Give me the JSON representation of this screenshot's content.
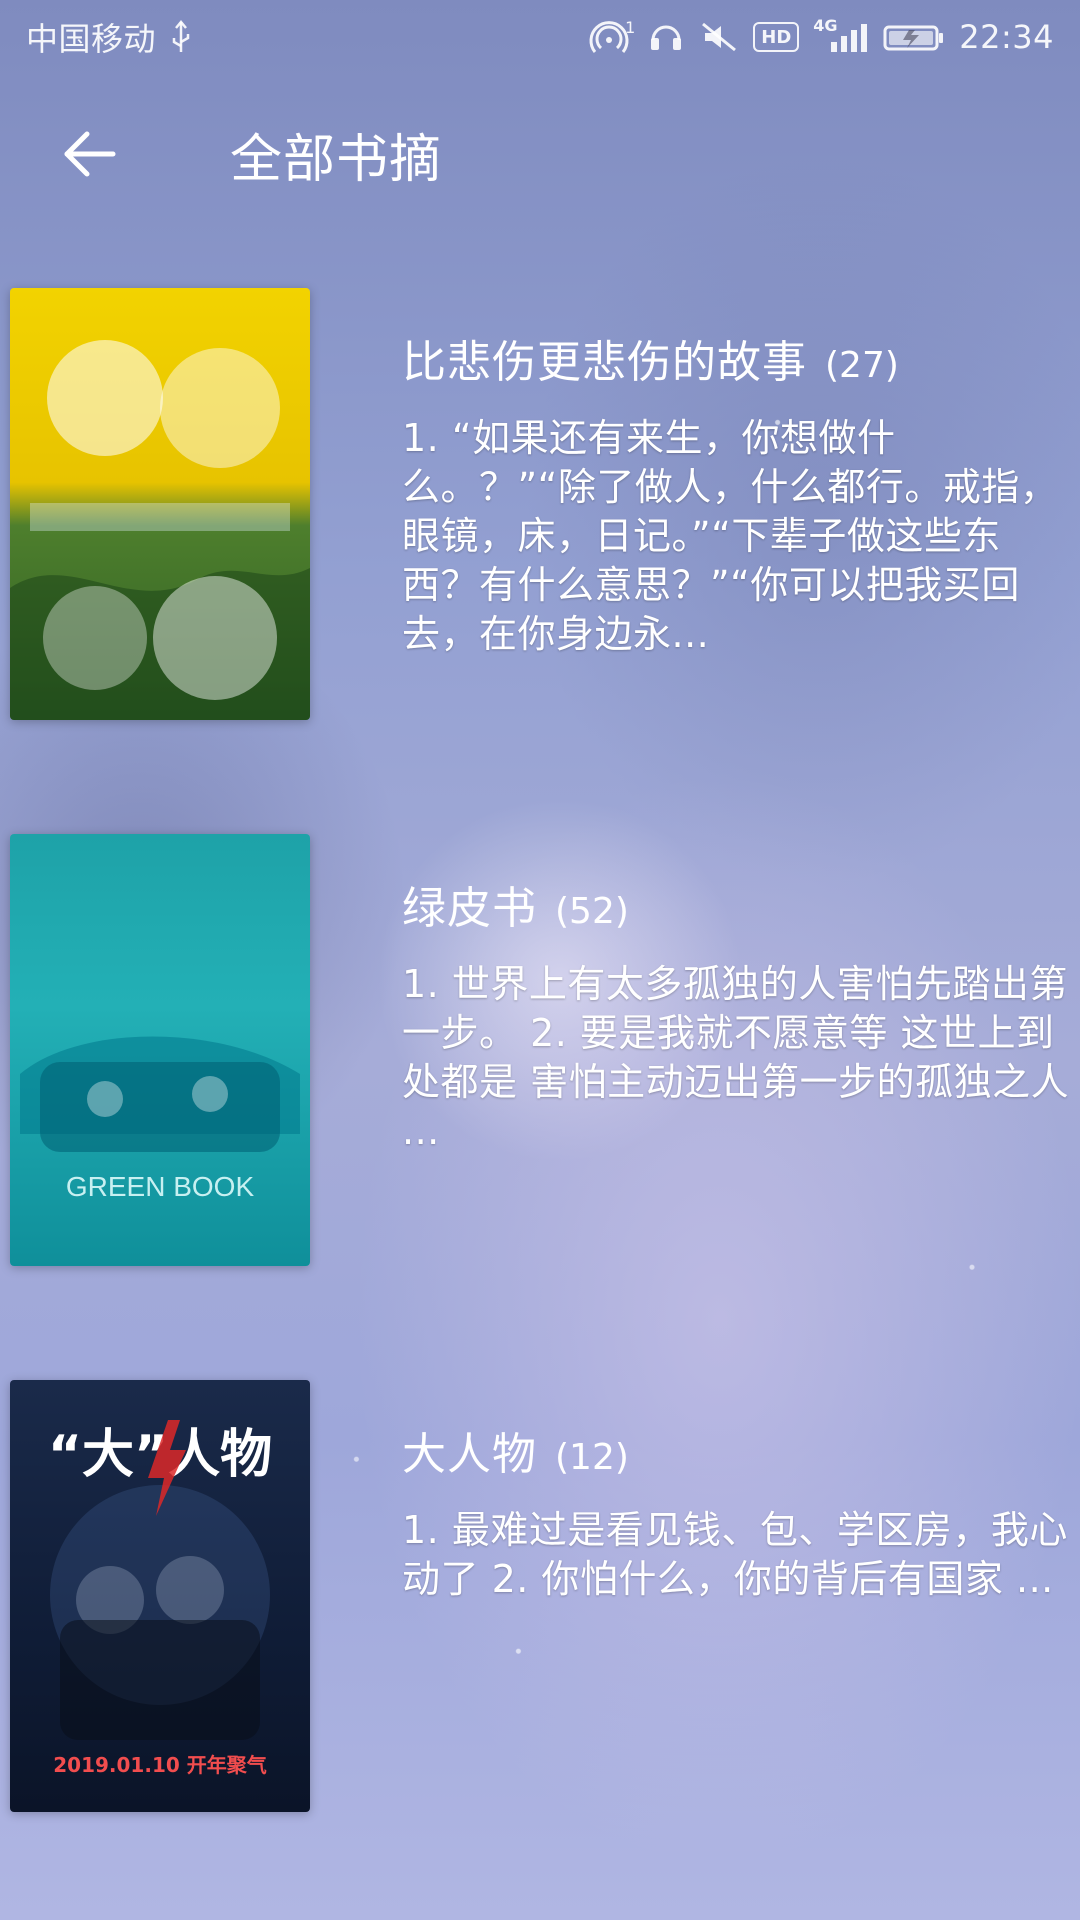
{
  "status_bar": {
    "carrier": "中国移动",
    "hotspot_badge": "1",
    "hd_badge": "HD",
    "network_label": "4G",
    "time": "22:34"
  },
  "header": {
    "title": "全部书摘"
  },
  "items": [
    {
      "title": "比悲伤更悲伤的故事",
      "count": "(27)",
      "excerpt": "1. “如果还有来生，你想做什么。？”“除了做人，什么都行。戒指，眼镜，床，日记。”“下辈子做这些东西？有什么意思？”“你可以把我买回去，在你身边永...",
      "poster_icon": "movie-poster"
    },
    {
      "title": "绿皮书",
      "count": "(52)",
      "excerpt": "1. 世界上有太多孤独的人害怕先踏出第一步。 2. 要是我就不愿意等 这世上到处都是 害怕主动迈出第一步的孤独之人 ...",
      "poster_icon": "movie-poster",
      "poster_text": "GREEN BOOK"
    },
    {
      "title": "大人物",
      "count": "(12)",
      "excerpt": "1. 最难过是看见钱、包、学区房，我心动了 2. 你怕什么，你的背后有国家 ...",
      "poster_icon": "movie-poster",
      "poster_text": "“大”人物",
      "poster_subtext": "2019.01.10 开年聚气"
    }
  ],
  "colors": {
    "text": "#ffffff",
    "background_tint": "#9ea7da"
  }
}
